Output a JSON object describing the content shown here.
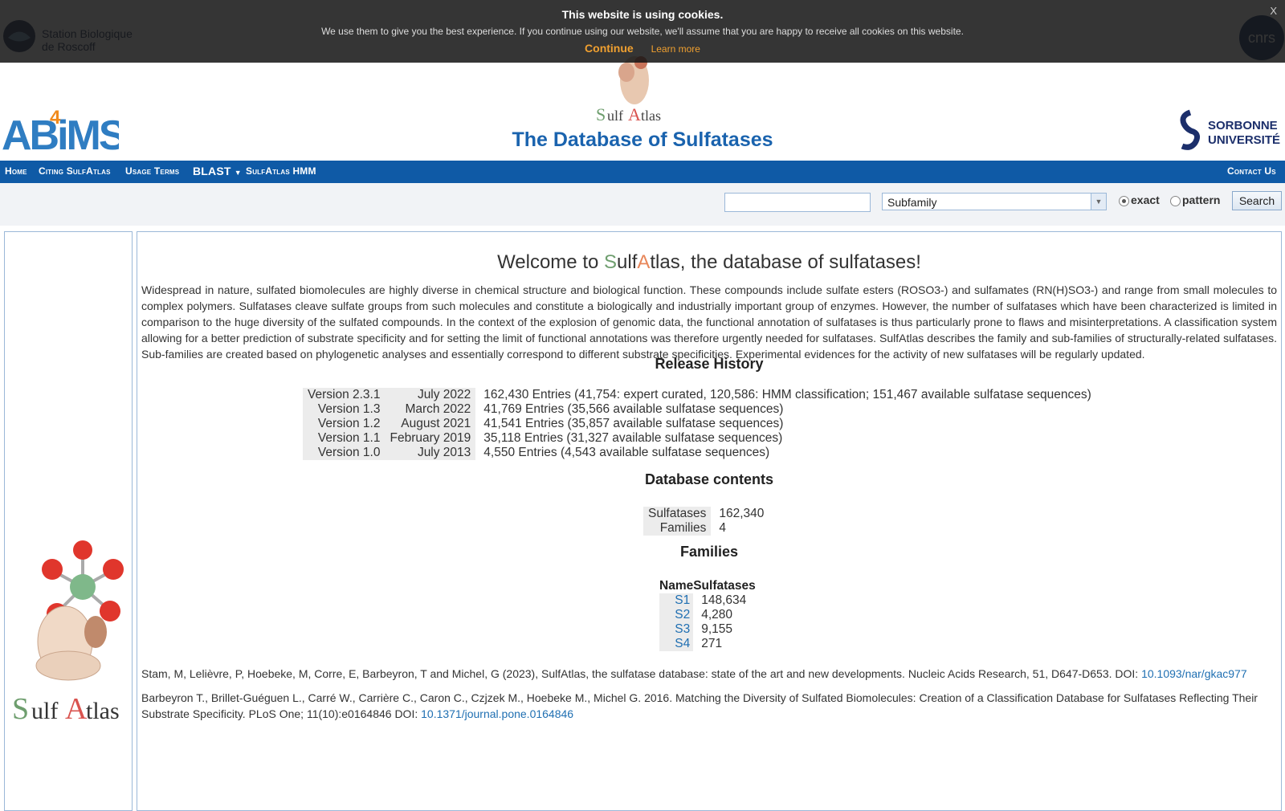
{
  "cookie_bar": {
    "title": "This website is using cookies.",
    "text": "We use them to give you the best experience. If you continue using our website, we'll assume that you are happy to receive all cookies on this website.",
    "continue_label": "Continue",
    "learn_more_label": "Learn more",
    "close_label": "X"
  },
  "header": {
    "title": "The Database of Sulfatases",
    "logo_left_top": "Station Biologique de Roscoff",
    "logo_right_top": "cnrs",
    "logo_left": "ABiMS",
    "logo_right": "SORBONNE UNIVERSITÉ",
    "logo_center": "SulfAtlas"
  },
  "nav": {
    "items": [
      {
        "label": "Home"
      },
      {
        "label": "Citing SulfAtlas"
      },
      {
        "label": "Usage Terms"
      },
      {
        "label": "BLAST"
      },
      {
        "label": "SulfAtlas HMM"
      }
    ],
    "contact_label": "Contact Us"
  },
  "search": {
    "input_value": "",
    "field_selected": "Subfamily",
    "radio_exact_label": "exact",
    "radio_pattern_label": "pattern",
    "radio_selected": "exact",
    "button_label": "Search"
  },
  "main": {
    "welcome_prefix": "Welcome to ",
    "welcome_s": "S",
    "welcome_ulf": "ulf",
    "welcome_a": "A",
    "welcome_suffix": "tlas, the database of sulfatases!",
    "intro": "Widespread in nature, sulfated biomolecules are highly diverse in chemical structure and biological function. These compounds include sulfate esters (ROSO3-) and sulfamates (RN(H)SO3-) and range from small molecules to complex polymers. Sulfatases cleave sulfate groups from such molecules and constitute a biologically and industrially important group of enzymes. However, the number of sulfatases which have been characterized is limited in comparison to the huge diversity of the sulfated compounds. In the context of the explosion of genomic data, the functional annotation of sulfatases is thus particularly prone to flaws and misinterpretations. A classification system allowing for a better prediction of substrate specificity and for setting the limit of functional annotations was therefore urgently needed for sulfatases. SulfAtlas describes the family and sub-families of structurally-related sulfatases. Sub-families are created based on phylogenetic analyses and essentially correspond to different substrate specificities. Experimental evidences for the activity of new sulfatases will be regularly updated.",
    "release_history_title": "Release History",
    "releases": [
      {
        "version": "Version 2.3.1",
        "date": "July 2022",
        "desc": "162,430 Entries (41,754: expert curated, 120,586: HMM classification; 151,467 available sulfatase sequences)"
      },
      {
        "version": "Version 1.3",
        "date": "March 2022",
        "desc": "41,769 Entries (35,566 available sulfatase sequences)"
      },
      {
        "version": "Version 1.2",
        "date": "August 2021",
        "desc": "41,541 Entries (35,857 available sulfatase sequences)"
      },
      {
        "version": "Version 1.1",
        "date": "February 2019",
        "desc": "35,118 Entries (31,327 available sulfatase sequences)"
      },
      {
        "version": "Version 1.0",
        "date": "July 2013",
        "desc": "4,550 Entries (4,543 available sulfatase sequences)"
      }
    ],
    "database_contents_title": "Database contents",
    "contents": [
      {
        "label": "Sulfatases",
        "value": "162,340"
      },
      {
        "label": "Families",
        "value": "4"
      }
    ],
    "families_title": "Families",
    "families_header": {
      "name": "Name",
      "count": "Sulfatases"
    },
    "families": [
      {
        "name": "S1",
        "count": "148,634"
      },
      {
        "name": "S2",
        "count": "4,280"
      },
      {
        "name": "S3",
        "count": "9,155"
      },
      {
        "name": "S4",
        "count": "271"
      }
    ],
    "ref1_text": "Stam, M, Lelièvre, P, Hoebeke, M, Corre, E, Barbeyron, T and Michel, G (2023), SulfAtlas, the sulfatase database: state of the art and new developments. Nucleic Acids Research, 51, D647-D653. DOI: ",
    "ref1_doi": "10.1093/nar/gkac977",
    "ref2_text": "Barbeyron T., Brillet-Guéguen L., Carré W., Carrière C., Caron C., Czjzek M., Hoebeke M., Michel G. 2016. Matching the Diversity of Sulfated Biomolecules: Creation of a Classification Database for Sulfatases Reflecting Their Substrate Specificity. PLoS One; 11(10):e0164846 DOI: ",
    "ref2_doi": "10.1371/journal.pone.0164846"
  },
  "colors": {
    "nav_bg": "#0f5aa6",
    "title_blue": "#1a63ae",
    "link_blue": "#1f6fb2",
    "cookie_accent": "#f0a030"
  }
}
